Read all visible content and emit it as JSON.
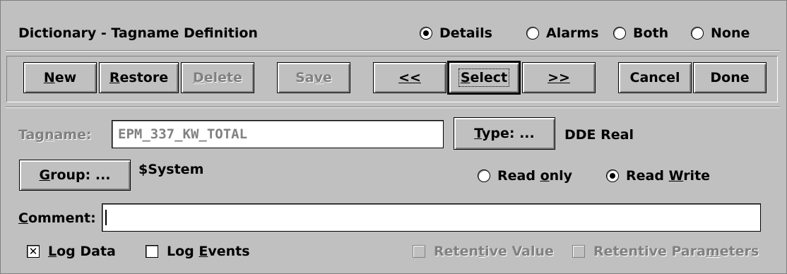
{
  "window": {
    "title": "Dictionary - Tagname Definition"
  },
  "view_mode": {
    "options": [
      {
        "label": "Details",
        "selected": true
      },
      {
        "label": "Alarms",
        "selected": false
      },
      {
        "label": "Both",
        "selected": false
      },
      {
        "label": "None",
        "selected": false
      }
    ]
  },
  "toolbar": {
    "new": {
      "label": "New",
      "mnemonic": "N",
      "rest": "ew"
    },
    "restore": {
      "label": "Restore",
      "mnemonic": "R",
      "rest": "estore"
    },
    "delete": {
      "label": "Delete",
      "mnemonic": "D",
      "rest": "elete",
      "enabled": false
    },
    "save": {
      "pre": "Sa",
      "mnemonic": "v",
      "rest": "e",
      "enabled": false
    },
    "prev": {
      "label": "<<"
    },
    "select": {
      "label": "Select",
      "mnemonic": "S",
      "rest": "elect"
    },
    "next": {
      "label": ">>"
    },
    "cancel": {
      "label": "Cancel"
    },
    "done": {
      "label": "Done"
    }
  },
  "tagname": {
    "label_pre": "Tag",
    "label_mn": "n",
    "label_post": "ame:",
    "value": "EPM_337_KW_TOTAL"
  },
  "type": {
    "button_mn": "T",
    "button_rest": "ype: ...",
    "value": "DDE Real"
  },
  "group": {
    "button_mn": "G",
    "button_rest": "roup: ...",
    "value": "$System"
  },
  "access": {
    "read_only": {
      "pre": "Read ",
      "mn": "o",
      "post": "nly",
      "selected": false
    },
    "read_write": {
      "pre": "Read ",
      "mn": "W",
      "post": "rite",
      "selected": true
    }
  },
  "comment": {
    "label_mn": "C",
    "label_rest": "omment:",
    "value": ""
  },
  "options": {
    "log_data": {
      "mn": "L",
      "rest": "og Data",
      "checked": true,
      "check_glyph": "✕"
    },
    "log_events": {
      "pre": "Log ",
      "mn": "E",
      "post": "vents",
      "checked": false
    },
    "retentive_value": {
      "pre": "Reten",
      "mn": "t",
      "post": "ive Value",
      "checked": false,
      "enabled": false
    },
    "retentive_parameters": {
      "pre": "Retentive Para",
      "mn": "m",
      "post": "eters",
      "checked": false,
      "enabled": false
    }
  },
  "colors": {
    "face": "#c0c0c0",
    "shadow": "#808080",
    "highlight": "#ffffff",
    "text": "#000000",
    "disabled": "#808080"
  }
}
